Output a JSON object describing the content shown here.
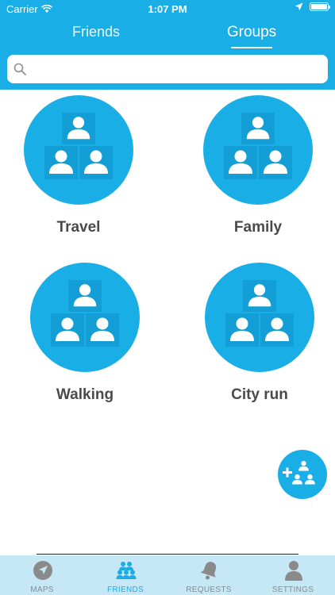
{
  "status_bar": {
    "carrier": "Carrier",
    "time": "1:07 PM"
  },
  "tabs": [
    {
      "label": "Friends",
      "active": false
    },
    {
      "label": "Groups",
      "active": true
    }
  ],
  "search": {
    "placeholder": "",
    "value": ""
  },
  "groups": [
    {
      "name": "Travel"
    },
    {
      "name": "Family"
    },
    {
      "name": "Walking"
    },
    {
      "name": "City run"
    }
  ],
  "bottom_nav": [
    {
      "label": "MAPS",
      "icon": "navigation-icon",
      "active": false
    },
    {
      "label": "FRIENDS",
      "icon": "people-icon",
      "active": true
    },
    {
      "label": "REQUESTS",
      "icon": "bell-icon",
      "active": false
    },
    {
      "label": "SETTINGS",
      "icon": "person-icon",
      "active": false
    }
  ],
  "colors": {
    "accent": "#1aaee6",
    "nav_background": "#c6e8f6",
    "text_dark": "#4a4a4a",
    "nav_inactive": "#8a8a8a"
  }
}
